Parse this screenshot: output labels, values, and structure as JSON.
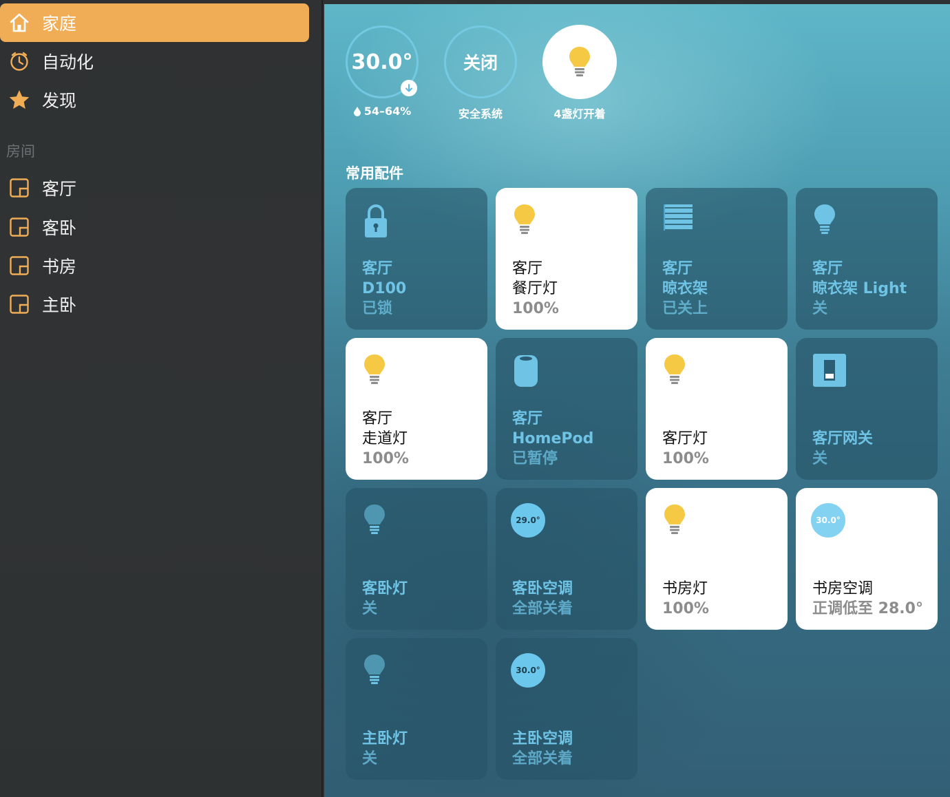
{
  "sidebar": {
    "nav": [
      {
        "label": "家庭",
        "icon": "house-icon",
        "active": true
      },
      {
        "label": "自动化",
        "icon": "clock-icon",
        "active": false
      },
      {
        "label": "发现",
        "icon": "star-icon",
        "active": false
      }
    ],
    "rooms_title": "房间",
    "rooms": [
      {
        "label": "客厅",
        "icon": "room-icon"
      },
      {
        "label": "客卧",
        "icon": "room-icon"
      },
      {
        "label": "书房",
        "icon": "room-icon"
      },
      {
        "label": "主卧",
        "icon": "room-icon"
      }
    ]
  },
  "status": {
    "climate": {
      "value": "30.0°",
      "label": "54–64%"
    },
    "security": {
      "value": "关闭",
      "label": "安全系统"
    },
    "lights": {
      "label": "4盏灯开着"
    }
  },
  "favorites_title": "常用配件",
  "tiles": [
    {
      "room": "客厅",
      "name": "D100",
      "status": "已锁",
      "icon": "lock-icon",
      "on": false
    },
    {
      "room": "客厅",
      "name": "餐厅灯",
      "status": "100%",
      "icon": "lightbulb-icon",
      "on": true
    },
    {
      "room": "客厅",
      "name": "晾衣架",
      "status": "已关上",
      "icon": "blinds-icon",
      "on": false
    },
    {
      "room": "客厅",
      "name": "晾衣架 Light",
      "status": "关",
      "icon": "lightbulb-icon",
      "on": false
    },
    {
      "room": "客厅",
      "name": "走道灯",
      "status": "100%",
      "icon": "lightbulb-icon",
      "on": true
    },
    {
      "room": "客厅",
      "name": "HomePod",
      "status": "已暂停",
      "icon": "homepod-icon",
      "on": false
    },
    {
      "room": "",
      "name": "客厅灯",
      "status": "100%",
      "icon": "lightbulb-icon",
      "on": true
    },
    {
      "room": "",
      "name": "客厅网关",
      "status": "关",
      "icon": "switch-icon",
      "on": false
    },
    {
      "room": "",
      "name": "客卧灯",
      "status": "关",
      "icon": "lightbulb-icon",
      "on": false
    },
    {
      "room": "",
      "name": "客卧空调",
      "status": "全部关着",
      "icon": "thermostat-icon",
      "temp": "29.0°",
      "on": false
    },
    {
      "room": "",
      "name": "书房灯",
      "status": "100%",
      "icon": "lightbulb-icon",
      "on": true
    },
    {
      "room": "",
      "name": "书房空调",
      "status": "正调低至 28.0°",
      "icon": "thermostat-icon",
      "temp": "30.0°",
      "on": true
    },
    {
      "room": "",
      "name": "主卧灯",
      "status": "关",
      "icon": "lightbulb-icon",
      "on": false
    },
    {
      "room": "",
      "name": "主卧空调",
      "status": "全部关着",
      "icon": "thermostat-icon",
      "temp": "30.0°",
      "on": false
    }
  ],
  "colors": {
    "accent": "#f0ad56",
    "sidebar_bg": "#303334",
    "bulb_on": "#f6c945",
    "tile_off_text": "#6fc4e6"
  }
}
